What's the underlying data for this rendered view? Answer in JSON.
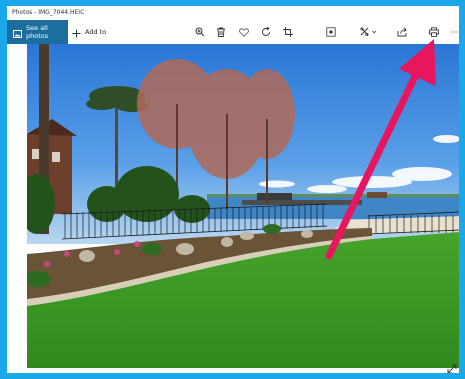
{
  "window": {
    "title": "Photos - IMG_7044.HEIC"
  },
  "toolbar": {
    "see_all_photos": "See all photos",
    "add_to": "Add to",
    "more": "···",
    "icons": [
      "zoom-in-icon",
      "delete-icon",
      "favorite-icon",
      "rotate-icon",
      "crop-icon",
      "enhance-icon",
      "edit-creative-icon",
      "share-icon",
      "print-icon",
      "more-icon"
    ]
  },
  "colors": {
    "window_border": "#1ba8e8",
    "see_all_bg": "#1c6e9f",
    "annotation_arrow": "#e8155f"
  },
  "photo": {
    "subject": "lakeside-lawn-photo"
  },
  "annotation": {
    "type": "arrow",
    "target": "print-icon"
  }
}
